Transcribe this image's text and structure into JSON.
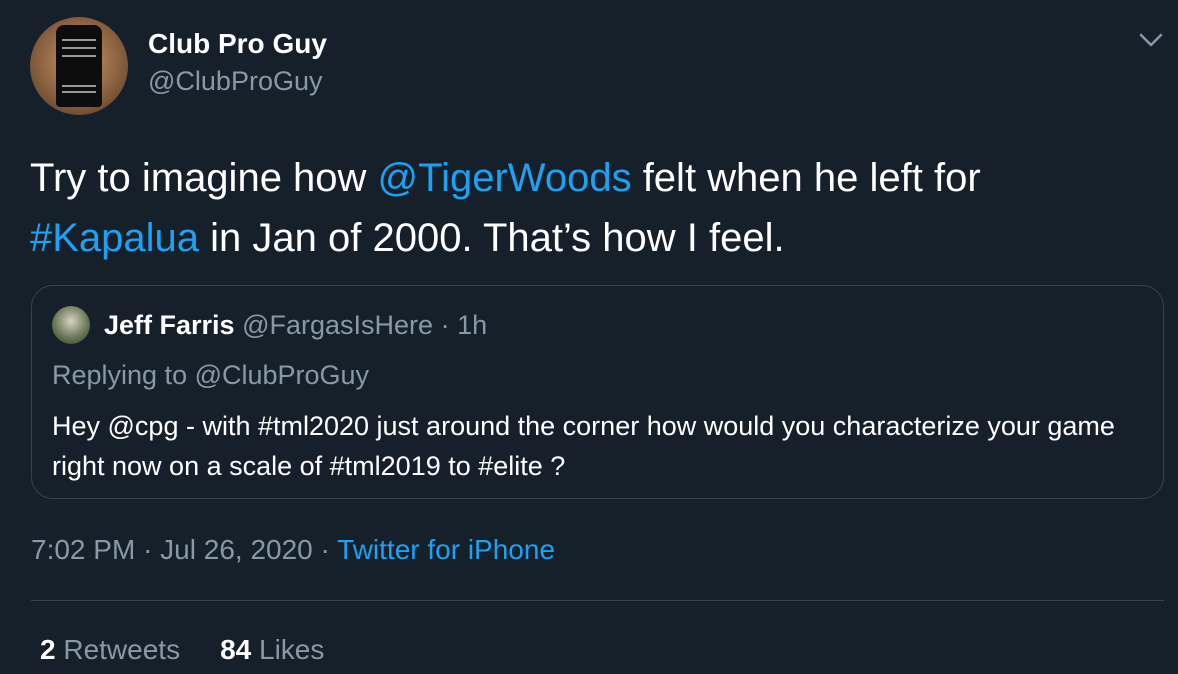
{
  "author": {
    "display_name": "Club Pro Guy",
    "handle": "@ClubProGuy"
  },
  "tweet": {
    "text_before_mention": "Try to imagine how ",
    "mention": "@TigerWoods",
    "text_after_mention": " felt when he left for ",
    "hashtag": "#Kapalua",
    "text_after_hashtag": " in Jan of 2000. That’s how I feel."
  },
  "quoted_tweet": {
    "display_name": "Jeff Farris",
    "handle": "@FargasIsHere",
    "separator": "·",
    "time_ago": "1h",
    "replying_to": "Replying to @ClubProGuy",
    "text": "Hey @cpg - with #tml2020 just around the corner how would you characterize your game right now on a scale of #tml2019 to #elite ?"
  },
  "meta": {
    "time": "7:02 PM",
    "separator": "·",
    "date": "Jul 26, 2020",
    "source": "Twitter for iPhone"
  },
  "stats": {
    "retweets_count": "2",
    "retweets_label": "Retweets",
    "likes_count": "84",
    "likes_label": "Likes"
  },
  "colors": {
    "background": "#15202b",
    "link": "#1da1f2",
    "secondary_text": "#8899a6",
    "border": "#38444d"
  },
  "icons": {
    "more": "chevron-down-icon"
  }
}
